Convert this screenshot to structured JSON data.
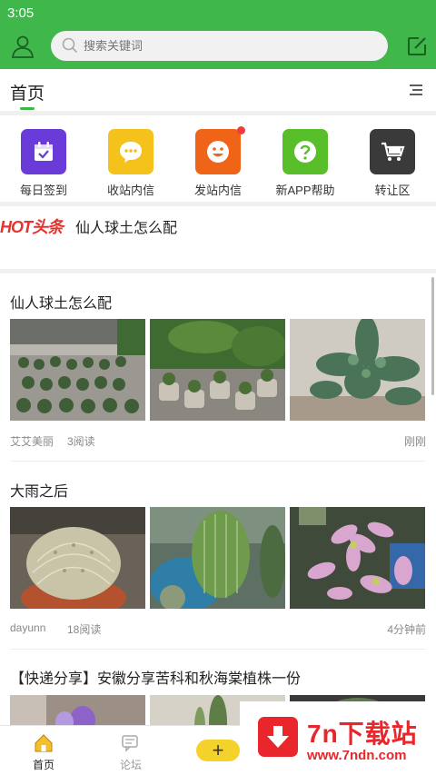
{
  "status_bar": {
    "time": "3:05"
  },
  "search": {
    "placeholder": "搜索关键词"
  },
  "tabs": {
    "home": "首页"
  },
  "quick_actions": [
    {
      "label": "每日签到",
      "icon": "calendar-check-icon",
      "color": "#6a3bd9"
    },
    {
      "label": "收站内信",
      "icon": "chat-bubble-icon",
      "color": "#f4c21a"
    },
    {
      "label": "发站内信",
      "icon": "smiley-icon",
      "color": "#f06418"
    },
    {
      "label": "新APP帮助",
      "icon": "help-question-icon",
      "color": "#58bf2b"
    },
    {
      "label": "转让区",
      "icon": "cart-icon",
      "color": "#3a3a3a"
    }
  ],
  "hot": {
    "badge": "HOT头条",
    "title": "仙人球土怎么配"
  },
  "posts": [
    {
      "title": "仙人球土怎么配",
      "author": "艾艾美丽",
      "views": "3阅读",
      "time": "刚刚"
    },
    {
      "title": "大雨之后",
      "author": "dayunn",
      "views": "18阅读",
      "time": "4分钟前"
    },
    {
      "title": "【快递分享】安徽分享苦科和秋海棠植株一份"
    }
  ],
  "bottom_nav": {
    "home": "首页",
    "forum": "论坛",
    "post": "+"
  },
  "watermark": {
    "title": "7n下载站",
    "url": "www.7ndn.com"
  },
  "colors": {
    "brand_green": "#3fb74a",
    "accent_red": "#e8262b",
    "post_button": "#f5d22b"
  }
}
